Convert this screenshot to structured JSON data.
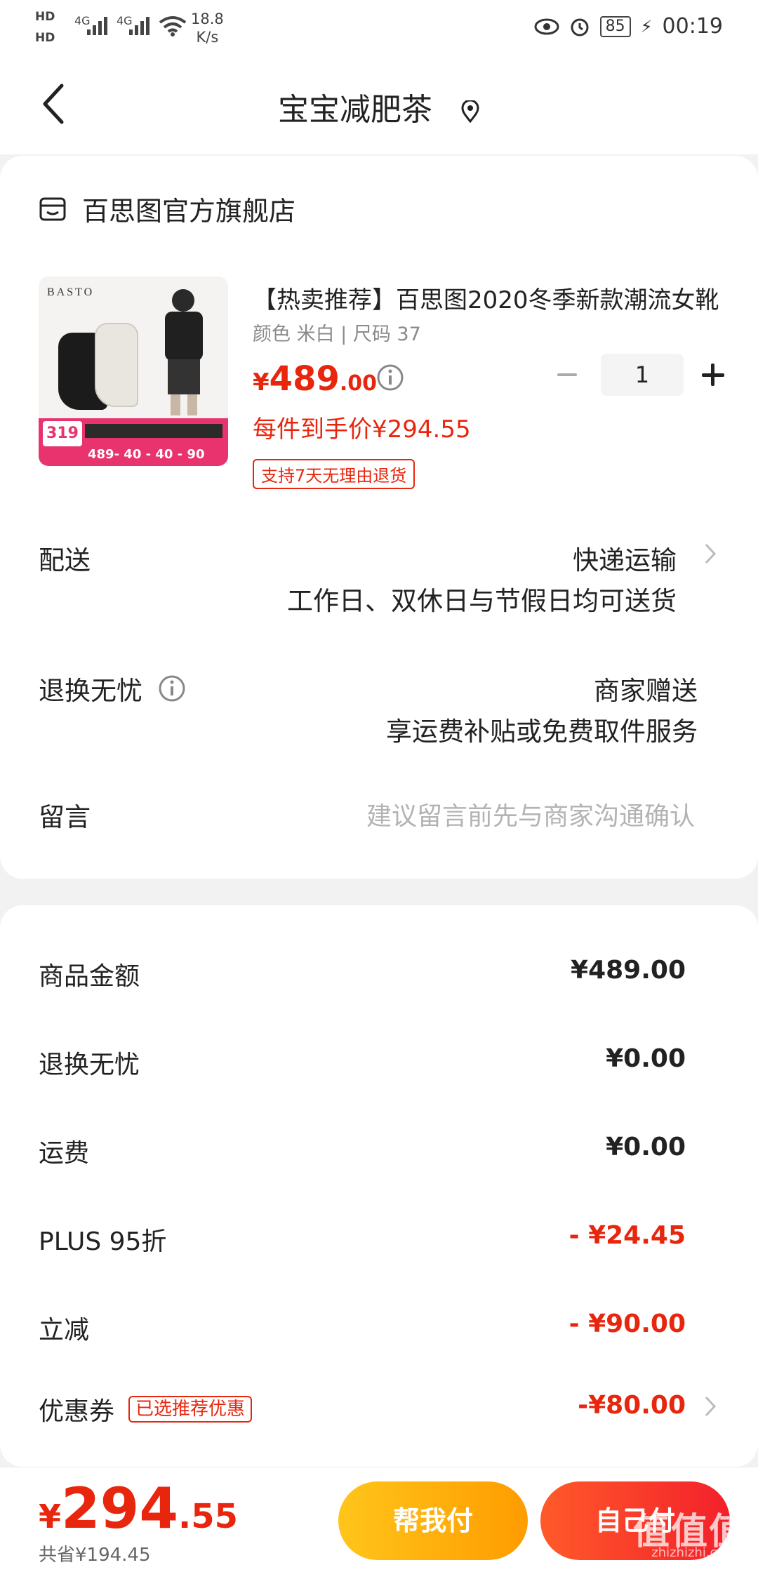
{
  "status_bar": {
    "hd1": "HD",
    "hd2": "HD",
    "net1": "4G",
    "net2": "4G",
    "speed_value": "18.8",
    "speed_unit": "K/s",
    "battery": "85",
    "time": "00:19"
  },
  "header": {
    "title": "宝宝减肥茶"
  },
  "shop": {
    "name": "百思图官方旗舰店"
  },
  "product": {
    "image_brand": "BASTO",
    "image_price": "319",
    "image_promo": "489- 40 - 40 - 90",
    "name": "【热卖推荐】百思图2020冬季新款潮流女靴",
    "spec": "颜色 米白 | 尺码 37",
    "price_currency": "¥",
    "price_int": "489",
    "price_dec": ".00",
    "quantity": "1",
    "unit_price": "每件到手价¥294.55",
    "return_tag": "支持7天无理由退货"
  },
  "delivery": {
    "label": "配送",
    "value": "快递运输",
    "desc": "工作日、双休日与节假日均可送货"
  },
  "returns": {
    "label": "退换无忧",
    "value": "商家赠送",
    "desc": "享运费补贴或免费取件服务"
  },
  "message": {
    "label": "留言",
    "placeholder": "建议留言前先与商家沟通确认"
  },
  "summary": [
    {
      "label": "商品金额",
      "value": "¥489.00"
    },
    {
      "label": "退换无忧",
      "value": "¥0.00"
    },
    {
      "label": "运费",
      "value": "¥0.00"
    },
    {
      "label": "PLUS 95折",
      "value": "- ¥24.45"
    },
    {
      "label": "立减",
      "value": "- ¥90.00"
    },
    {
      "label": "优惠券",
      "tag": "已选推荐优惠",
      "value": "-¥80.00"
    }
  ],
  "bottom": {
    "total_currency": "¥",
    "total_int": "294",
    "total_dec": ".55",
    "saved": "共省¥194.45",
    "help_pay": "帮我付",
    "self_pay": "自己付"
  },
  "watermark": {
    "main": "值值值",
    "sub": "zhizhizhi.com"
  },
  "colors": {
    "accent_red": "#e8260e",
    "help_button": "#ffb300",
    "self_button": "#f3202b"
  }
}
